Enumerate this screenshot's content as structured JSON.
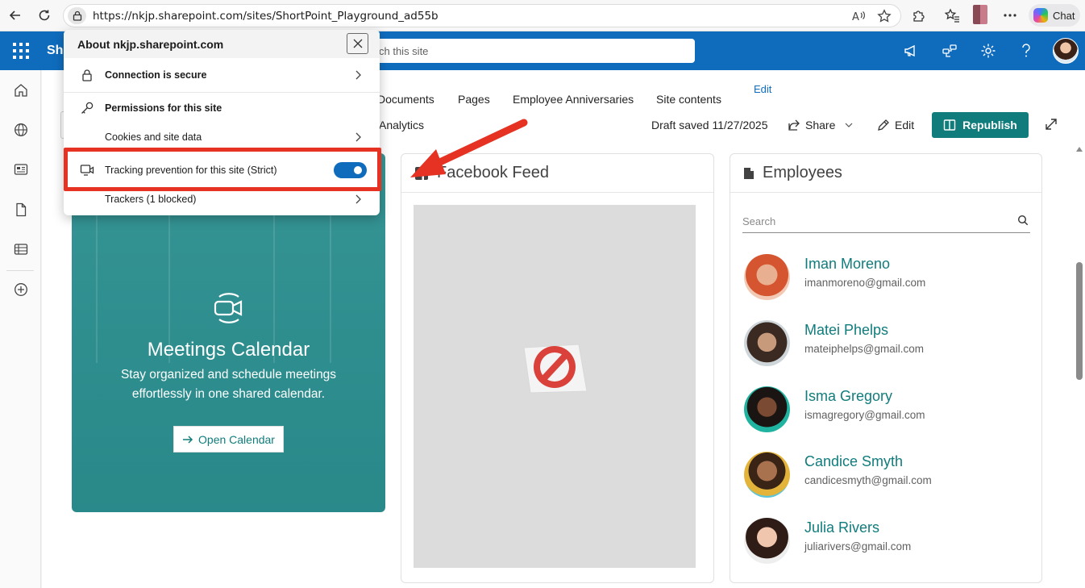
{
  "browser": {
    "url": "https://nkjp.sharepoint.com/sites/ShortPoint_Playground_ad55b",
    "chat_label": "Chat"
  },
  "suite": {
    "title_fragment": "Sha",
    "search_placeholder_fragment": "ch this site",
    "accent_color": "#0f6cbd"
  },
  "hub_nav": {
    "items": [
      "Documents",
      "Pages",
      "Employee Anniversaries",
      "Site contents"
    ],
    "edit_label": "Edit",
    "second_row_item": "Analytics"
  },
  "command_bar": {
    "draft_status": "Draft saved 11/27/2025",
    "share_label": "Share",
    "edit_label": "Edit",
    "republish_label": "Republish",
    "republish_color": "#107c7c"
  },
  "site_info_popup": {
    "title": "About nkjp.sharepoint.com",
    "rows": [
      {
        "label": "Connection is secure",
        "icon": "lock-icon"
      },
      {
        "label": "Permissions for this site",
        "icon": "key-icon"
      },
      {
        "label": "Cookies and site data",
        "icon": ""
      },
      {
        "label": "Tracking prevention for this site (Strict)",
        "icon": "tracking-icon",
        "toggle_on": true
      },
      {
        "label": "Trackers (1 blocked)",
        "icon": ""
      }
    ]
  },
  "meetings_card": {
    "title": "Meetings Calendar",
    "description": "Stay organized and schedule meetings effortlessly in one shared calendar.",
    "button_label": "Open Calendar",
    "overlay_color": "#1e8c8c"
  },
  "facebook_card": {
    "title": "Facebook Feed"
  },
  "employees_card": {
    "title": "Employees",
    "search_placeholder": "Search",
    "people": [
      {
        "name": "Iman Moreno",
        "email": "imanmoreno@gmail.com"
      },
      {
        "name": "Matei Phelps",
        "email": "mateiphelps@gmail.com"
      },
      {
        "name": "Isma Gregory",
        "email": "ismagregory@gmail.com"
      },
      {
        "name": "Candice Smyth",
        "email": "candicesmyth@gmail.com"
      },
      {
        "name": "Julia Rivers",
        "email": "juliarivers@gmail.com"
      }
    ]
  },
  "annotation": {
    "highlight_color": "#e53222"
  }
}
